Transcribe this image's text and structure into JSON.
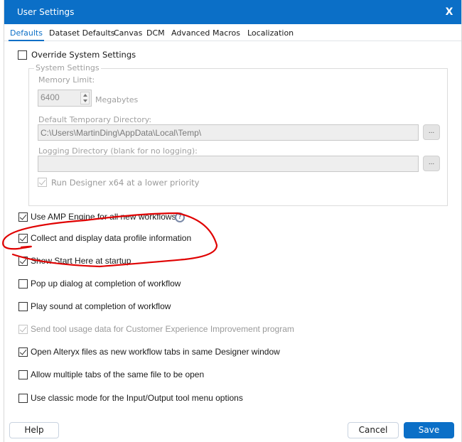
{
  "window": {
    "title": "User Settings",
    "close_glyph": "X",
    "accent_color": "#0b6fc7"
  },
  "tabs": [
    {
      "label": "Defaults",
      "active": true
    },
    {
      "label": "Dataset Defaults",
      "active": false
    },
    {
      "label": "Canvas",
      "active": false
    },
    {
      "label": "DCM",
      "active": false
    },
    {
      "label": "Advanced",
      "active": false
    },
    {
      "label": "Macros",
      "active": false
    },
    {
      "label": "Localization",
      "active": false
    }
  ],
  "override": {
    "label": "Override System Settings",
    "checked": false
  },
  "system_settings": {
    "legend": "System Settings",
    "memory_limit_label": "Memory Limit:",
    "memory_limit_value": "6400",
    "memory_unit": "Megabytes",
    "temp_dir_label": "Default Temporary Directory:",
    "temp_dir_value": "C:\\Users\\MartinDing\\AppData\\Local\\Temp\\",
    "logging_dir_label": "Logging Directory (blank for no logging):",
    "logging_dir_value": "",
    "browse_label": "...",
    "lower_priority_label": "Run Designer x64 at a lower priority",
    "lower_priority_checked": true
  },
  "options": [
    {
      "label": "Use AMP Engine for all new workflows",
      "checked": true,
      "disabled": false,
      "has_help": true
    },
    {
      "label": "Collect and display data profile information",
      "checked": true,
      "disabled": false,
      "has_help": false
    },
    {
      "label": "Show Start Here at startup",
      "checked": true,
      "disabled": false,
      "has_help": false
    },
    {
      "label": "Pop up dialog at completion of workflow",
      "checked": false,
      "disabled": false,
      "has_help": false
    },
    {
      "label": "Play sound at completion of workflow",
      "checked": false,
      "disabled": false,
      "has_help": false
    },
    {
      "label": "Send tool usage data for Customer Experience Improvement program",
      "checked": true,
      "disabled": true,
      "has_help": false
    },
    {
      "label": "Open Alteryx files as new workflow tabs in same Designer window",
      "checked": true,
      "disabled": false,
      "has_help": false
    },
    {
      "label": "Allow multiple tabs of the same file to be open",
      "checked": false,
      "disabled": false,
      "has_help": false
    },
    {
      "label": "Use classic mode for the Input/Output tool menu options",
      "checked": false,
      "disabled": false,
      "has_help": false
    }
  ],
  "help_icon_glyph": "?",
  "footer": {
    "help_label": "Help",
    "cancel_label": "Cancel",
    "save_label": "Save"
  },
  "annotation": {
    "type": "red-freehand-circle",
    "target": "Collect and display data profile information",
    "color": "#e00000"
  }
}
